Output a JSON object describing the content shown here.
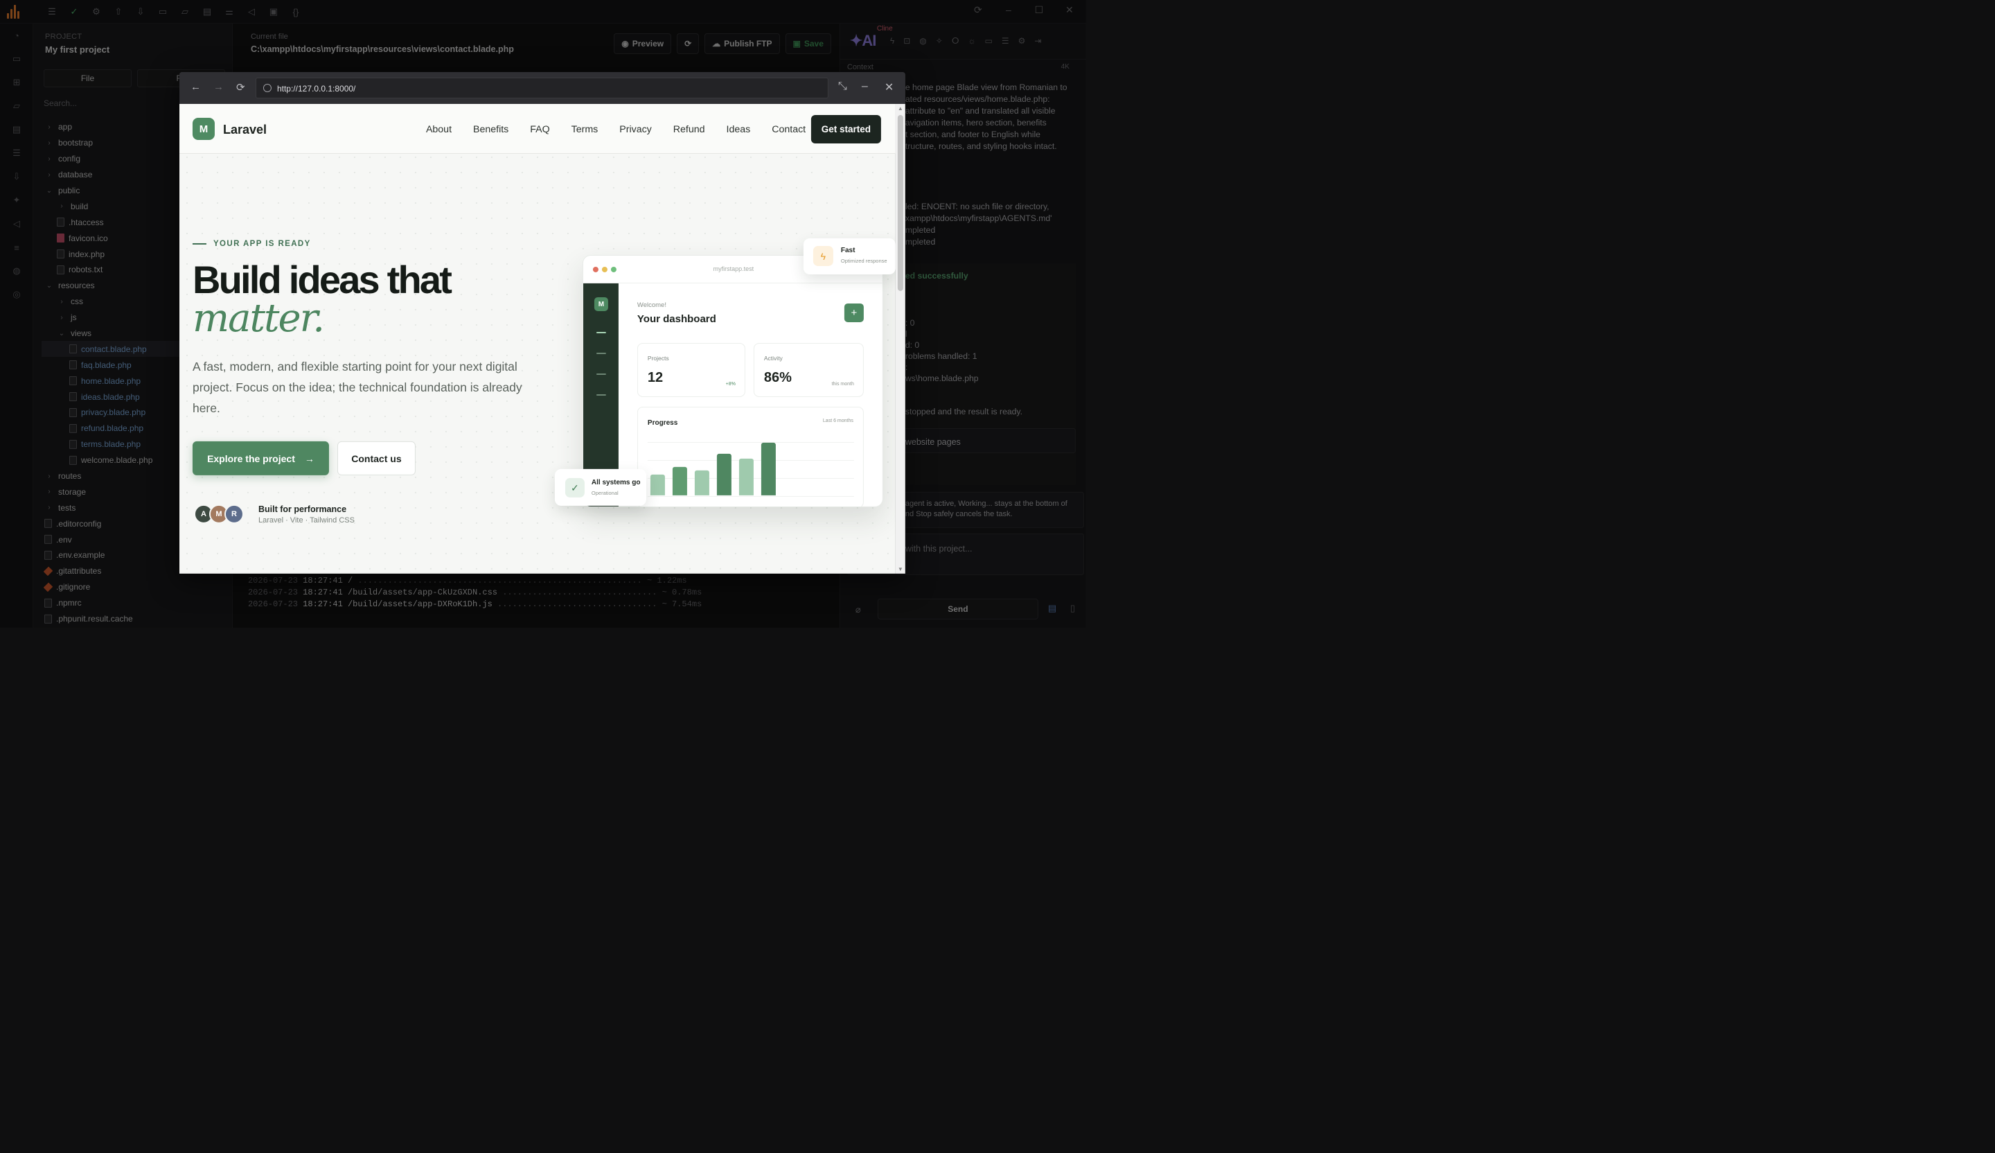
{
  "ide": {
    "toolbar_icons": [
      "menu-icon",
      "check-circle-icon",
      "gear-icon",
      "upload-icon",
      "download-icon",
      "box-icon",
      "folder-icon",
      "terminal-icon",
      "sliders-icon",
      "megaphone-icon",
      "console-icon",
      "braces-icon"
    ],
    "window_controls": [
      "refresh-icon",
      "minimize-icon",
      "maximize-icon",
      "close-icon"
    ],
    "project_label": "PROJECT",
    "project_name": "My first project",
    "explorer_tabs": [
      "File",
      "Fo"
    ],
    "search_placeholder": "Search...",
    "tree": [
      {
        "label": "app",
        "type": "folder",
        "depth": 0,
        "open": false
      },
      {
        "label": "bootstrap",
        "type": "folder",
        "depth": 0,
        "open": false
      },
      {
        "label": "config",
        "type": "folder",
        "depth": 0,
        "open": false
      },
      {
        "label": "database",
        "type": "folder",
        "depth": 0,
        "open": false
      },
      {
        "label": "public",
        "type": "folder",
        "depth": 0,
        "open": true
      },
      {
        "label": "build",
        "type": "folder",
        "depth": 1,
        "open": false
      },
      {
        "label": ".htaccess",
        "type": "file",
        "depth": 1
      },
      {
        "label": "favicon.ico",
        "type": "file",
        "depth": 1,
        "kind": "fav"
      },
      {
        "label": "index.php",
        "type": "file",
        "depth": 1
      },
      {
        "label": "robots.txt",
        "type": "file",
        "depth": 1
      },
      {
        "label": "resources",
        "type": "folder",
        "depth": 0,
        "open": true
      },
      {
        "label": "css",
        "type": "folder",
        "depth": 1,
        "open": false
      },
      {
        "label": "js",
        "type": "folder",
        "depth": 1,
        "open": false
      },
      {
        "label": "views",
        "type": "folder",
        "depth": 1,
        "open": true
      },
      {
        "label": "contact.blade.php",
        "type": "file",
        "depth": 2,
        "kind": "blade",
        "selected": true
      },
      {
        "label": "faq.blade.php",
        "type": "file",
        "depth": 2,
        "kind": "blade"
      },
      {
        "label": "home.blade.php",
        "type": "file",
        "depth": 2,
        "kind": "blade"
      },
      {
        "label": "ideas.blade.php",
        "type": "file",
        "depth": 2,
        "kind": "blade"
      },
      {
        "label": "privacy.blade.php",
        "type": "file",
        "depth": 2,
        "kind": "blade"
      },
      {
        "label": "refund.blade.php",
        "type": "file",
        "depth": 2,
        "kind": "blade"
      },
      {
        "label": "terms.blade.php",
        "type": "file",
        "depth": 2,
        "kind": "blade"
      },
      {
        "label": "welcome.blade.php",
        "type": "file",
        "depth": 2
      },
      {
        "label": "routes",
        "type": "folder",
        "depth": 0,
        "open": false
      },
      {
        "label": "storage",
        "type": "folder",
        "depth": 0,
        "open": false
      },
      {
        "label": "tests",
        "type": "folder",
        "depth": 0,
        "open": false
      },
      {
        "label": ".editorconfig",
        "type": "file",
        "depth": 0
      },
      {
        "label": ".env",
        "type": "file",
        "depth": 0
      },
      {
        "label": ".env.example",
        "type": "file",
        "depth": 0
      },
      {
        "label": ".gitattributes",
        "type": "file",
        "depth": 0,
        "kind": "git"
      },
      {
        "label": ".gitignore",
        "type": "file",
        "depth": 0,
        "kind": "git"
      },
      {
        "label": ".npmrc",
        "type": "file",
        "depth": 0
      },
      {
        "label": ".phpunit.result.cache",
        "type": "file",
        "depth": 0
      }
    ],
    "current_file_label": "Current file",
    "current_file_path": "C:\\xampp\\htdocs\\myfirstapp\\resources\\views\\contact.blade.php",
    "buttons": {
      "preview": "Preview",
      "publish": "Publish FTP",
      "save": "Save"
    },
    "log": [
      {
        "date": "2026-07-23",
        "time": "18:27:41",
        "path": "/",
        "dots": " .........................................................",
        "dur": "~ 1.22ms"
      },
      {
        "date": "2026-07-23",
        "time": "18:27:41",
        "path": "/build/assets/app-CkUzGXDN.css",
        "dots": " ...............................",
        "dur": "~ 0.78ms"
      },
      {
        "date": "2026-07-23",
        "time": "18:27:41",
        "path": "/build/assets/app-DXRoK1Dh.js",
        "dots": " ................................",
        "dur": "~ 7.54ms"
      }
    ],
    "chat": {
      "ai_logo": "AI",
      "cline": "Cline",
      "context_label": "Context",
      "context_size": "4K",
      "lines": [
        "e home page Blade view from Romanian to",
        "ated resources/views/home.blade.php:",
        " attribute to \"en\" and translated all visible",
        "avigation items, hero section, benefits",
        "t section, and footer to English while",
        "tructure, routes, and styling hooks intact."
      ],
      "error_lines": [
        "led: ENOENT: no such file or directory,",
        "xampp\\htdocs\\myfirstapp\\AGENTS.md'",
        "mpleted",
        "mpleted"
      ],
      "success": "ed successfully",
      "stats": [
        ": 0",
        "l",
        "d: 0",
        "roblems handled: 1",
        ":",
        "ws\\home.blade.php"
      ],
      "done": "stopped and the result is ready.",
      "task": "website pages",
      "note": "agent is active, Working... stays at the bottom of the d Stop safely cancels the task.",
      "note_a": "agent is active, Working... stays at the bottom of",
      "note_b": "nd Stop safely cancels the task.",
      "input_placeholder": "with this project...",
      "send": "Send"
    }
  },
  "browser": {
    "url": "http://127.0.0.1:8000/",
    "nav_buttons": [
      "back-icon",
      "forward-icon",
      "reload-icon"
    ],
    "controls": [
      "collapse-icon",
      "minimize-icon",
      "close-icon"
    ]
  },
  "site": {
    "brand_letter": "M",
    "brand": "Laravel",
    "nav": [
      "About",
      "Benefits",
      "FAQ",
      "Terms",
      "Privacy",
      "Refund",
      "Ideas",
      "Contact"
    ],
    "cta": "Get started",
    "eyebrow": "YOUR APP IS READY",
    "headline_1": "Build ideas that",
    "headline_2": "matter.",
    "lead": "A fast, modern, and flexible starting point for your next digital project. Focus on the idea; the technical foundation is already here.",
    "btn_primary": "Explore the project",
    "btn_primary_arrow": "→",
    "btn_secondary": "Contact us",
    "avatars": [
      {
        "letter": "A",
        "color": "#3d4a42"
      },
      {
        "letter": "M",
        "color": "#a37a5f"
      },
      {
        "letter": "R",
        "color": "#5d6d8c"
      }
    ],
    "perf_title": "Built for performance",
    "perf_sub": "Laravel · Vite · Tailwind CSS",
    "mock": {
      "host": "myfirstapp.test",
      "welcome": "Welcome!",
      "title": "Your dashboard",
      "plus": "+",
      "stat1": {
        "label": "Projects",
        "value": "12",
        "delta": "+8%"
      },
      "stat2": {
        "label": "Activity",
        "value": "86%",
        "delta": "this month"
      },
      "progress_title": "Progress",
      "progress_range": "Last 6 months",
      "bars": [
        0.39,
        0.52,
        0.46,
        0.77,
        0.68,
        0.97,
        0.3
      ]
    },
    "fast": {
      "title": "Fast",
      "sub": "Optimized response"
    },
    "ok": {
      "title": "All systems go",
      "sub": "Operational"
    }
  }
}
